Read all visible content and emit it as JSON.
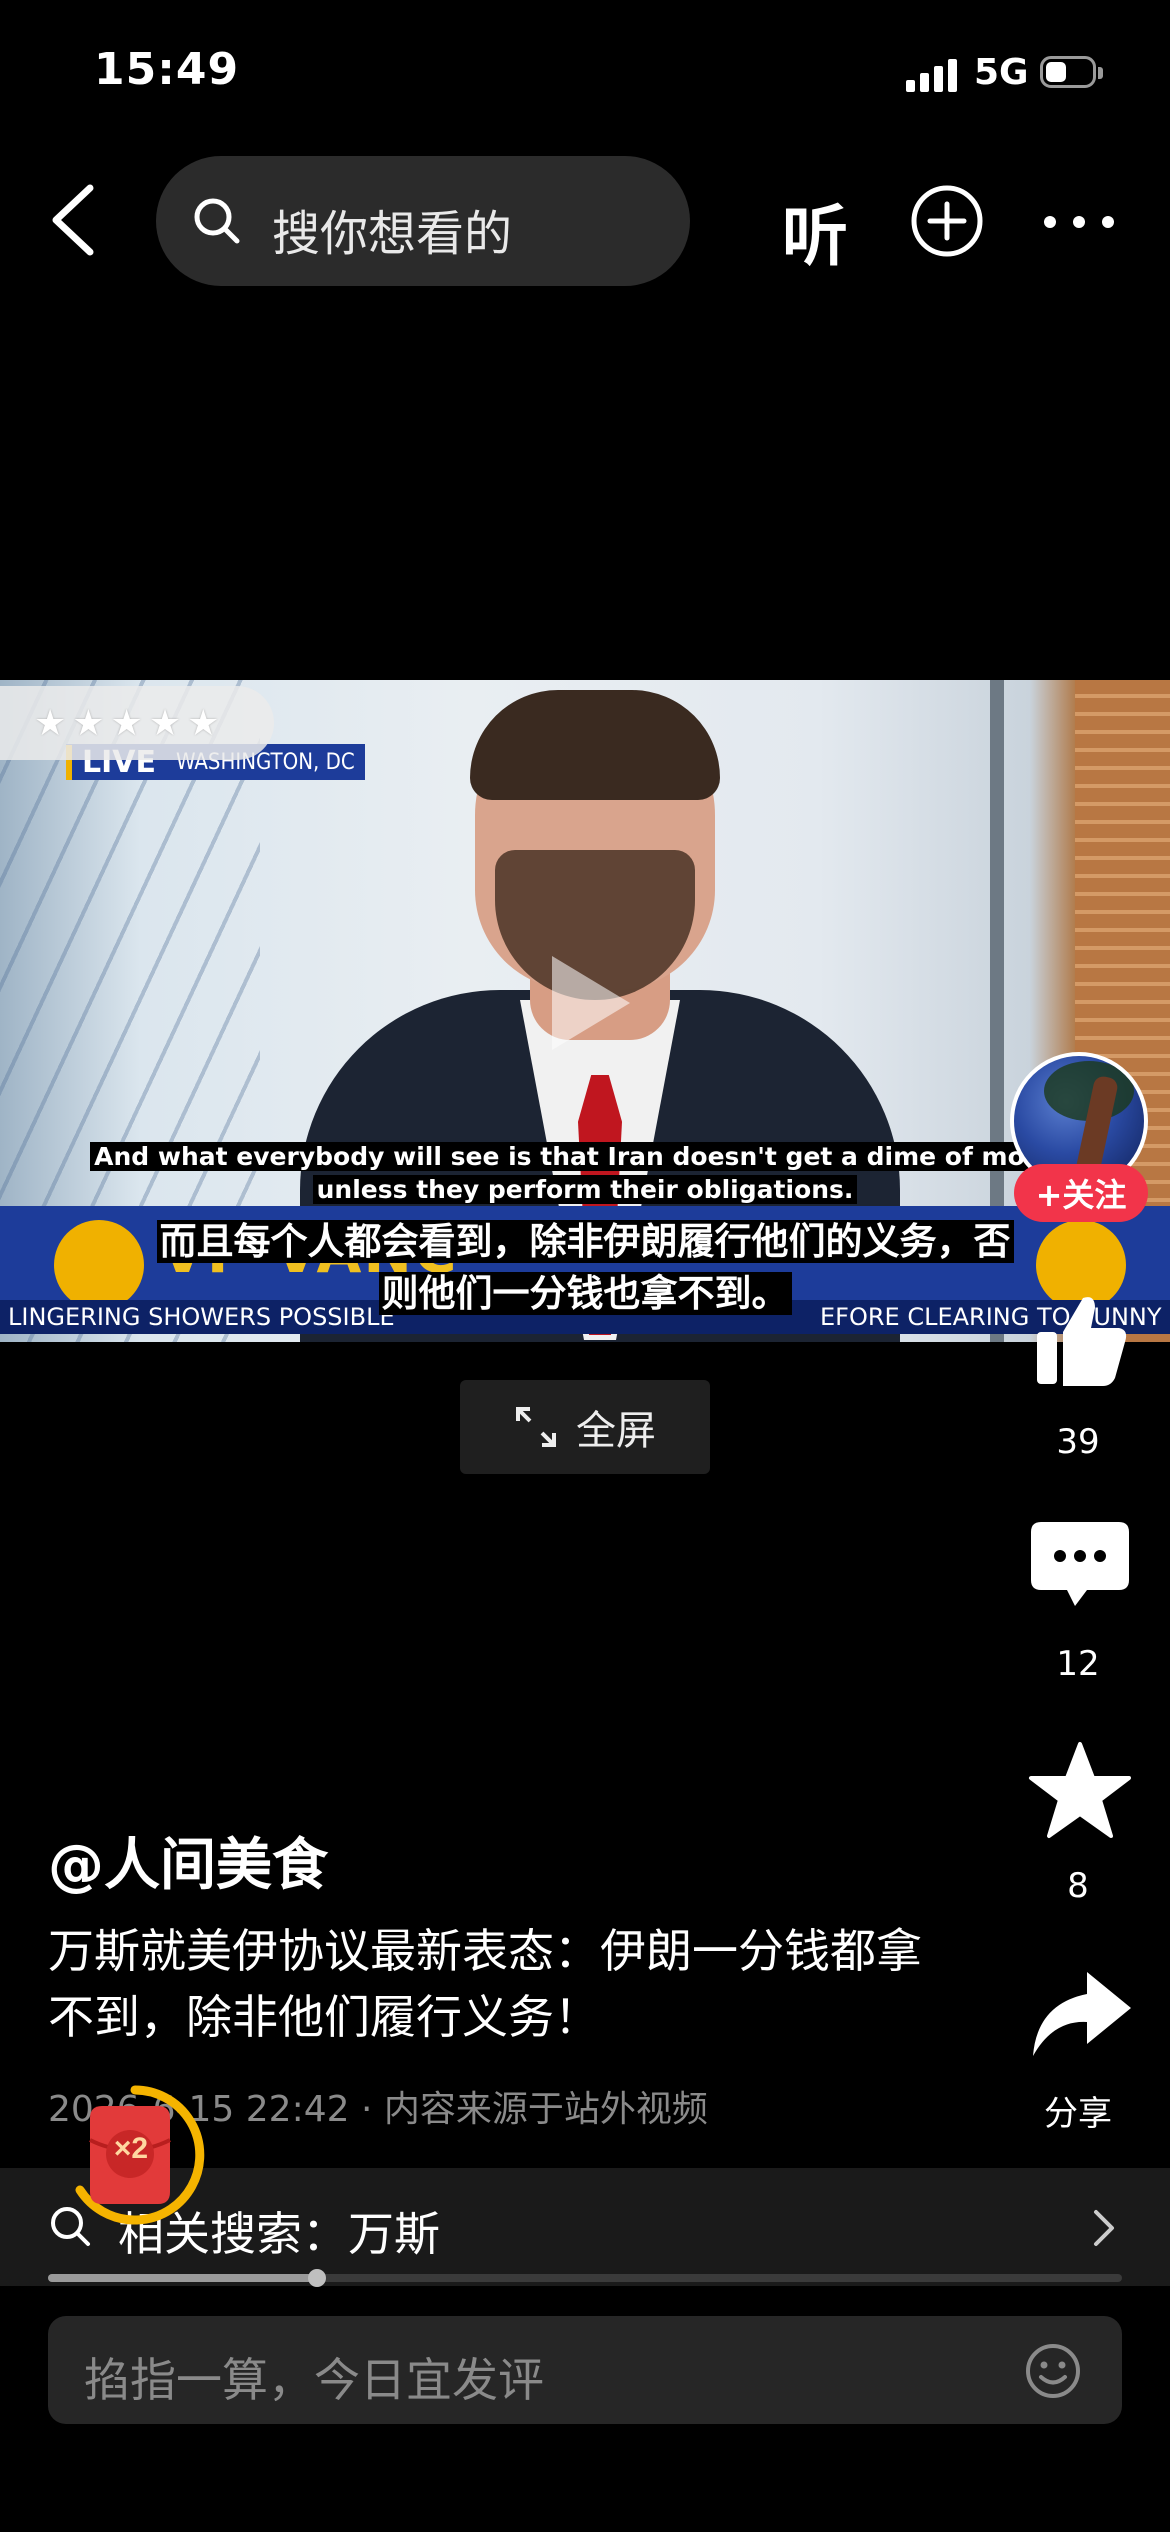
{
  "status_bar": {
    "time": "15:49",
    "network": "5G"
  },
  "top_nav": {
    "search_placeholder": "搜你想看的",
    "listen_label": "听"
  },
  "video": {
    "live_label": "LIVE",
    "live_location": "WASHINGTON, DC",
    "star_rating": "★★★★★",
    "lower_third_title": "VP VANC",
    "ticker_left": "LINGERING SHOWERS POSSIBLE",
    "ticker_right": "EFORE CLEARING TO SUNNY SKIE",
    "subtitle_en_line1": "And what everybody will see is that Iran doesn't get a dime of money",
    "subtitle_en_line2": "unless they perform their obligations.",
    "subtitle_zh_line1": "而且每个人都会看到，除非伊朗履行他们的义务，否",
    "subtitle_zh_line2": "则他们一分钱也拿不到。",
    "progress_fraction": 0.25
  },
  "fullscreen_label": "全屏",
  "rail": {
    "follow_label": "+关注",
    "like_count": "39",
    "comment_count": "12",
    "favorite_count": "8",
    "share_label": "分享"
  },
  "post": {
    "author": "@人间美食",
    "title": "万斯就美伊协议最新表态：伊朗一分钱都拿不到，除非他们履行义务！",
    "meta": "2026-6-15 22:42 · 内容来源于站外视频"
  },
  "reward_badge": "×2",
  "related_search": "相关搜索：万斯",
  "comment_placeholder": "掐指一算，今日宜发评",
  "colors": {
    "accent_red": "#f2344a",
    "reward_gold": "#f5b400"
  }
}
